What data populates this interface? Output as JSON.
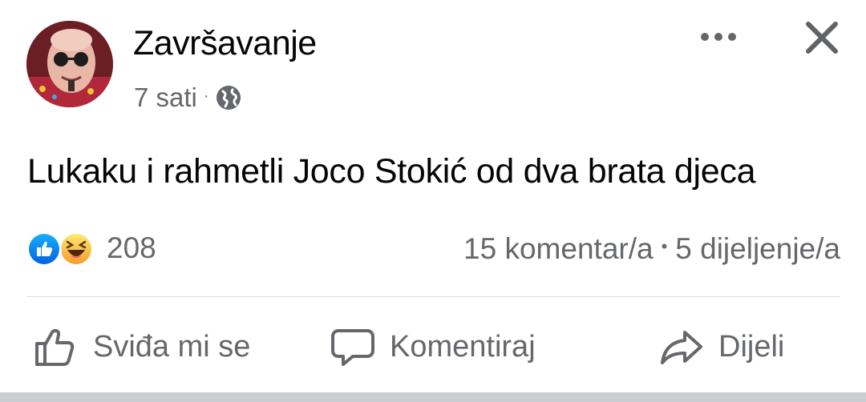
{
  "post": {
    "page_name": "Završavanje",
    "time": "7 sati",
    "separator": "·",
    "audience_icon": "globe-icon",
    "text": "Lukaku i rahmetli Joco Stokić od dva brata djeca"
  },
  "header_actions": {
    "more_icon": "more-horizontal-icon",
    "close_icon": "close-icon"
  },
  "reactions": {
    "types": [
      "like",
      "haha"
    ],
    "count": "208"
  },
  "stats": {
    "comments": "15 komentar/a",
    "bullet": "•",
    "shares": "5 dijeljenje/a"
  },
  "actions": {
    "like_label": "Sviđa mi se",
    "comment_label": "Komentiraj",
    "share_label": "Dijeli"
  },
  "colors": {
    "text_primary": "#050505",
    "text_secondary": "#65676b",
    "like_blue": "#1877f2",
    "haha_yellow": "#f7b125",
    "divider": "#dadde1"
  }
}
